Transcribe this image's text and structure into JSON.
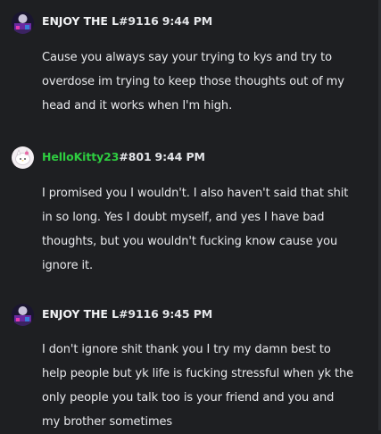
{
  "messages": [
    {
      "username": "ENJOY THE L",
      "tag": "#9116",
      "time": "9:44 PM",
      "username_color": "#f2f3f5",
      "lines": [
        "Cause you always say your trying to kys and try to",
        "overdose im trying to keep those thoughts out of my",
        "head and it works when I'm high."
      ]
    },
    {
      "username": "HelloKitty23",
      "tag": "#801",
      "time": "9:44 PM",
      "username_color": "#2ecc40",
      "lines": [
        "I promised you I wouldn't. I also haven't said that shit",
        "in so long. Yes I doubt myself, and yes I have bad",
        "thoughts, but you wouldn't fucking know cause you",
        "ignore it."
      ]
    },
    {
      "username": "ENJOY THE L",
      "tag": "#9116",
      "time": "9:45 PM",
      "username_color": "#f2f3f5",
      "lines": [
        "I don't ignore shit thank you I try my damn best to",
        "help people but yk life is fucking stressful when yk the",
        "only people you talk too is your friend and you and",
        "my brother sometimes"
      ]
    }
  ],
  "icons": {
    "avatar_1": "user-avatar-icon",
    "avatar_2": "hello-kitty-avatar-icon"
  }
}
